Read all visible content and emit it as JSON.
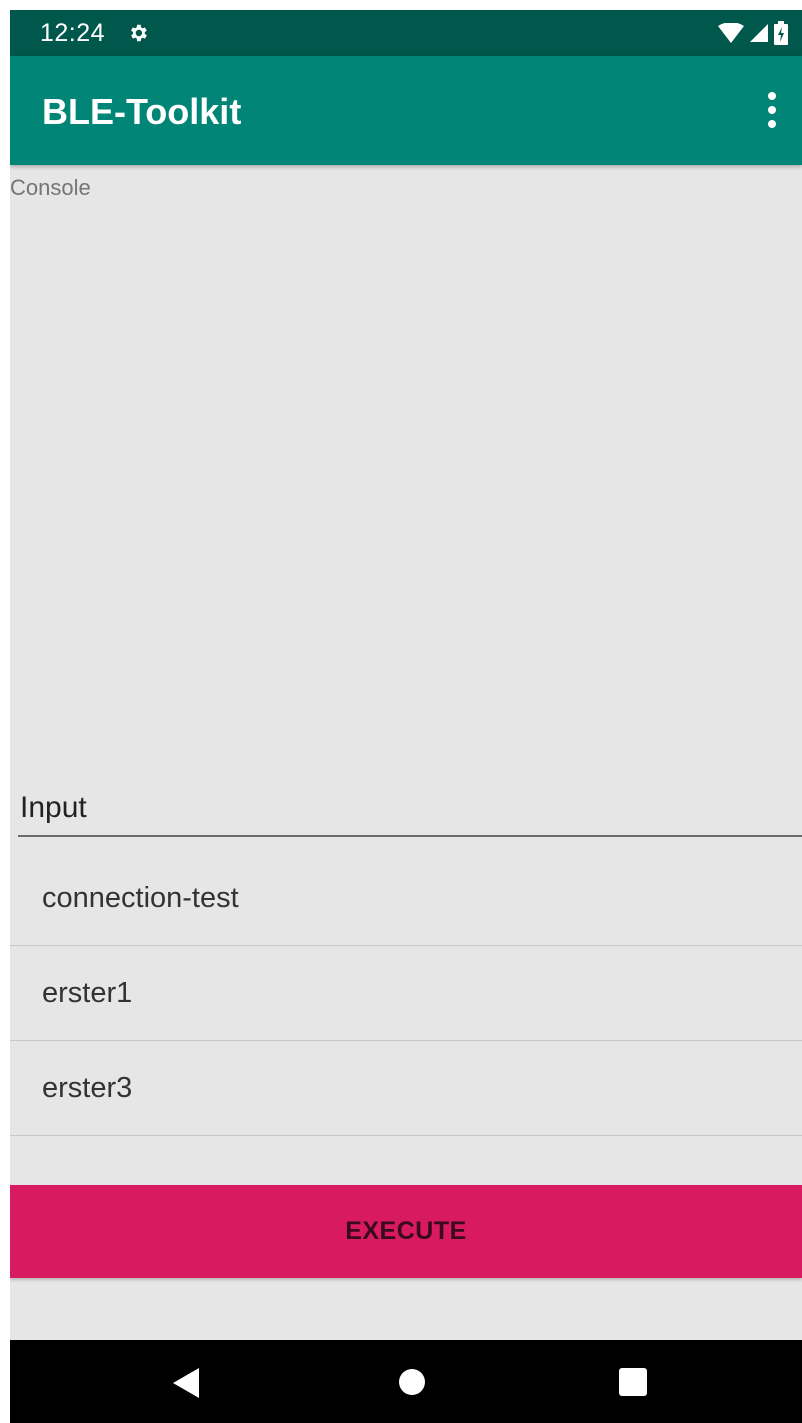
{
  "status_bar": {
    "time": "12:24",
    "icons": [
      "settings-gear-icon",
      "wifi-icon",
      "cell-signal-icon",
      "battery-icon"
    ]
  },
  "app_bar": {
    "title": "BLE-Toolkit",
    "menu_icon": "overflow-menu-icon"
  },
  "console": {
    "label": "Console"
  },
  "input": {
    "placeholder": "Input",
    "value": ""
  },
  "suggestions": [
    "connection-test",
    "erster1",
    "erster3"
  ],
  "execute_button": {
    "label": "EXECUTE"
  },
  "nav_bar": {
    "icons": [
      "back-icon",
      "home-icon",
      "recents-icon"
    ]
  },
  "colors": {
    "status_bar": "#00574b",
    "app_bar": "#008577",
    "accent": "#d81b60",
    "background": "#e6e6e6"
  }
}
